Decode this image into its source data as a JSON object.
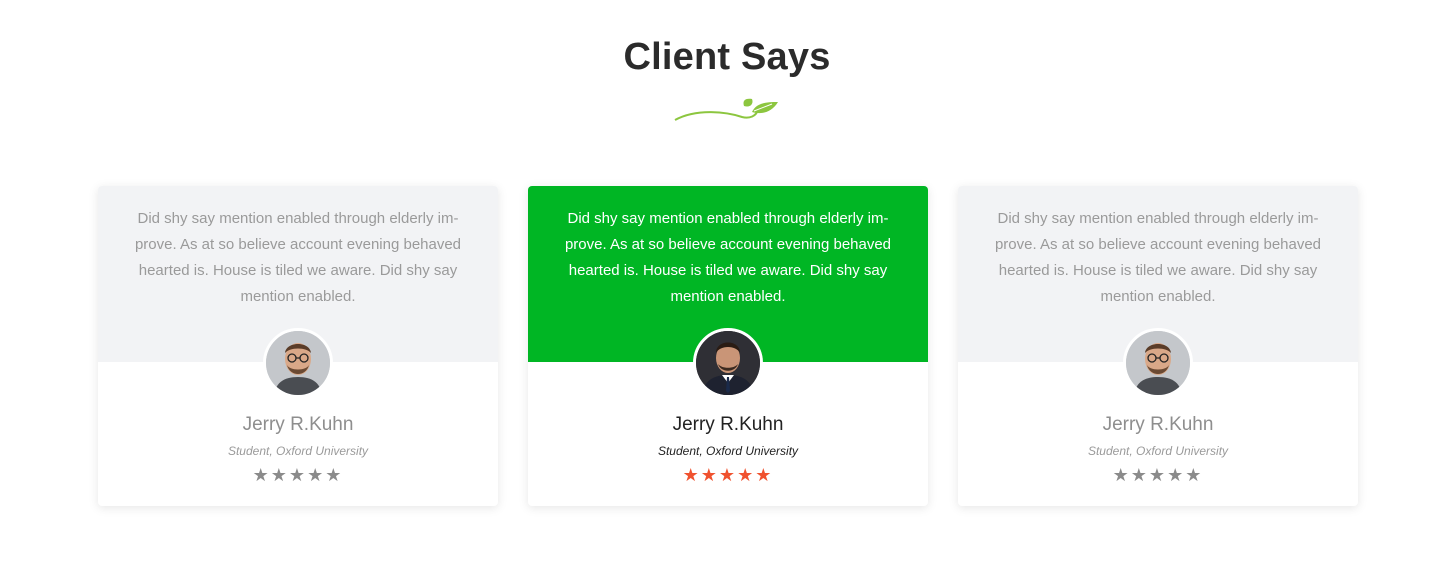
{
  "section": {
    "title": "Client Says",
    "accent_color": "#00b624",
    "leaf_icon": "leaf-divider-icon"
  },
  "testimonials": [
    {
      "quote": "Did shy say mention enabled through elderly im-prove. As at so believe account evening behaved hearted is. House is tiled we aware. Did shy say mention enabled.",
      "name": "Jerry R.Kuhn",
      "role": "Student, Oxford University",
      "rating": 5,
      "active": false
    },
    {
      "quote": "Did shy say mention enabled through elderly im-prove. As at so believe account evening behaved hearted is. House is tiled we aware. Did shy say mention enabled.",
      "name": "Jerry R.Kuhn",
      "role": "Student, Oxford University",
      "rating": 5,
      "active": true
    },
    {
      "quote": "Did shy say mention enabled through elderly im-prove. As at so believe account evening behaved hearted is. House is tiled we aware. Did shy say mention enabled.",
      "name": "Jerry R.Kuhn",
      "role": "Student, Oxford University",
      "rating": 5,
      "active": false
    }
  ],
  "colors": {
    "card_bg": "#f2f3f5",
    "active_card_bg": "#00b624",
    "star_inactive": "#8b8b8b",
    "star_active": "#f0522f"
  }
}
